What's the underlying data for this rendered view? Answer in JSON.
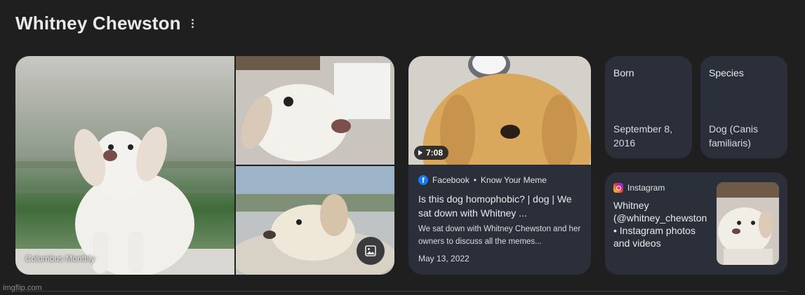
{
  "header": {
    "title": "Whitney Chewston"
  },
  "gallery": {
    "credit": "Columbus Monthly"
  },
  "video": {
    "duration": "7:08",
    "source": "Facebook",
    "separator": "•",
    "site": "Know Your Meme",
    "title": "Is this dog homophobic? | dog | We sat down with Whitney ...",
    "snippet": "We sat down with Whitney Chewston and her owners to discuss all the memes...",
    "date": "May 13, 2022"
  },
  "facts": [
    {
      "label": "Born",
      "value": "September 8, 2016"
    },
    {
      "label": "Species",
      "value": "Dog (Canis familiaris)"
    }
  ],
  "instagram": {
    "source": "Instagram",
    "title": "Whitney (@whitney_chewston • Instagram photos and videos"
  },
  "watermark": "imgflip.com",
  "colors": {
    "background": "#1f1f1f",
    "card": "#2b2f3a",
    "facebook": "#1877f2"
  },
  "icons": [
    "more-vert-icon",
    "play-icon",
    "facebook-icon",
    "instagram-icon",
    "image-icon"
  ]
}
